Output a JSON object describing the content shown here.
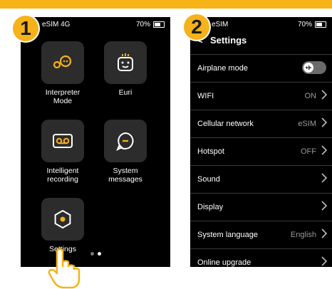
{
  "steps": {
    "one": "1",
    "two": "2"
  },
  "phone1": {
    "status": {
      "carrier": "eSIM 4G",
      "battery": "70%"
    },
    "apps": [
      {
        "label": "Interpreter\nMode"
      },
      {
        "label": "Euri"
      },
      {
        "label": "Intelligent\nrecording"
      },
      {
        "label": "System\nmessages"
      },
      {
        "label": "Settings"
      }
    ]
  },
  "phone2": {
    "status": {
      "carrier": "eSIM",
      "battery": "70%"
    },
    "header": {
      "back": "<",
      "title": "Settings"
    },
    "rows": [
      {
        "label": "Airplane mode",
        "value": ""
      },
      {
        "label": "WIFI",
        "value": "ON"
      },
      {
        "label": "Cellular network",
        "value": "eSIM"
      },
      {
        "label": "Hotspot",
        "value": "OFF"
      },
      {
        "label": "Sound",
        "value": ""
      },
      {
        "label": "Display",
        "value": ""
      },
      {
        "label": "System language",
        "value": "English"
      },
      {
        "label": "Online upgrade",
        "value": ""
      }
    ],
    "airplane_toggle_on": false
  },
  "colors": {
    "accent": "#f5b21a",
    "tile": "#2c2c2c",
    "screen": "#000000"
  },
  "icons": [
    "interpreter-icon",
    "euri-icon",
    "recording-icon",
    "messages-icon",
    "settings-icon",
    "airplane-icon",
    "chevron-right-icon",
    "hand-pointer-icon"
  ]
}
